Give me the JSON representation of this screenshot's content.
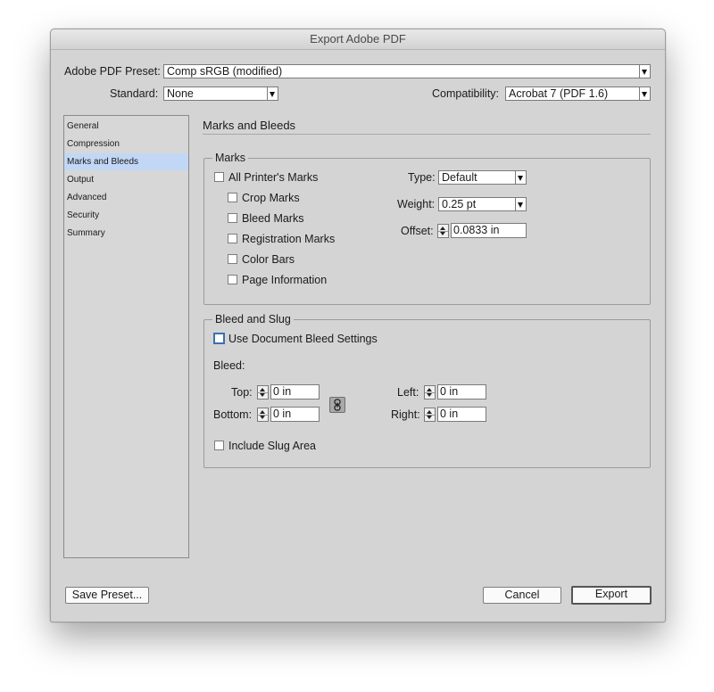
{
  "window": {
    "title": "Export Adobe PDF"
  },
  "preset": {
    "label": "Adobe PDF Preset:",
    "value": "Comp sRGB (modified)"
  },
  "standard": {
    "label": "Standard:",
    "value": "None"
  },
  "compatibility": {
    "label": "Compatibility:",
    "value": "Acrobat 7 (PDF 1.6)"
  },
  "sidebar": {
    "items": [
      {
        "label": "General"
      },
      {
        "label": "Compression"
      },
      {
        "label": "Marks and Bleeds",
        "selected": true
      },
      {
        "label": "Output"
      },
      {
        "label": "Advanced"
      },
      {
        "label": "Security"
      },
      {
        "label": "Summary"
      }
    ]
  },
  "section": {
    "title": "Marks and Bleeds"
  },
  "marks": {
    "legend": "Marks",
    "all_printers_marks": "All Printer's Marks",
    "options": [
      {
        "label": "Crop Marks",
        "checked": false
      },
      {
        "label": "Bleed Marks",
        "checked": false
      },
      {
        "label": "Registration Marks",
        "checked": false
      },
      {
        "label": "Color Bars",
        "checked": false
      },
      {
        "label": "Page Information",
        "checked": false
      }
    ],
    "type": {
      "label": "Type:",
      "value": "Default"
    },
    "weight": {
      "label": "Weight:",
      "value": "0.25 pt"
    },
    "offset": {
      "label": "Offset:",
      "value": "0.0833 in"
    }
  },
  "bleed_slug": {
    "legend": "Bleed and Slug",
    "use_document_bleed": "Use Document Bleed Settings",
    "bleed_label": "Bleed:",
    "top": {
      "label": "Top:",
      "value": "0 in"
    },
    "bottom": {
      "label": "Bottom:",
      "value": "0 in"
    },
    "left": {
      "label": "Left:",
      "value": "0 in"
    },
    "right": {
      "label": "Right:",
      "value": "0 in"
    },
    "include_slug": "Include Slug Area"
  },
  "buttons": {
    "save_preset": "Save Preset...",
    "cancel": "Cancel",
    "export": "Export"
  },
  "colors": {
    "dialog_bg": "#d4d4d4",
    "selection": "#c2d7f5",
    "focus_ring": "#3d6fb0"
  }
}
